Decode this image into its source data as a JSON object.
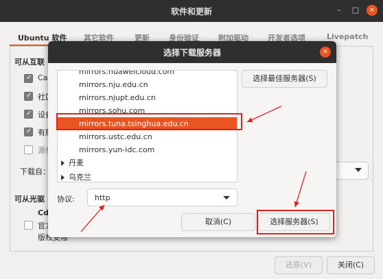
{
  "window": {
    "title": "软件和更新",
    "minimize_glyph": "–",
    "maximize_glyph": "□",
    "close_glyph": "×"
  },
  "tabs": [
    {
      "label": "Ubuntu 软件"
    },
    {
      "label": "其它软件"
    },
    {
      "label": "更新"
    },
    {
      "label": "身份验证"
    },
    {
      "label": "附加驱动"
    },
    {
      "label": "开发者选项"
    },
    {
      "label": "Livepatch"
    }
  ],
  "background": {
    "internet_heading": "可从互联",
    "options": [
      {
        "label": "Can",
        "checked": true
      },
      {
        "label": "社区",
        "checked": true
      },
      {
        "label": "设备",
        "checked": true
      },
      {
        "label": "有版",
        "checked": true
      },
      {
        "label": "源代",
        "checked": false
      }
    ],
    "download_label": "下载自：",
    "cdrom_heading": "可从光驱",
    "cdrom_item": {
      "title": "Cdr",
      "line1": "官方",
      "line2": "版权受限"
    }
  },
  "footer": {
    "revert_label": "还原(V)",
    "close_label": "关闭(C)"
  },
  "dialog": {
    "title": "选择下载服务器",
    "close_glyph": "×",
    "servers": [
      {
        "label": "mirrors.huaweicloud.com",
        "type": "item"
      },
      {
        "label": "mirrors.nju.edu.cn",
        "type": "item"
      },
      {
        "label": "mirrors.njupt.edu.cn",
        "type": "item"
      },
      {
        "label": "mirrors.sohu.com",
        "type": "item"
      },
      {
        "label": "mirrors.tuna.tsinghua.edu.cn",
        "type": "item",
        "selected": true
      },
      {
        "label": "mirrors.ustc.edu.cn",
        "type": "item"
      },
      {
        "label": "mirrors.yun-idc.com",
        "type": "item"
      },
      {
        "label": "丹麦",
        "type": "group"
      },
      {
        "label": "乌克兰",
        "type": "group"
      }
    ],
    "best_server_label": "选择最佳服务器(S)",
    "protocol_label": "协议:",
    "protocol_value": "http",
    "cancel_label": "取消(C)",
    "choose_label": "选择服务器(S)"
  },
  "colors": {
    "accent": "#e95420",
    "annotation": "#e02020",
    "titlebar": "#2f2f2f"
  }
}
